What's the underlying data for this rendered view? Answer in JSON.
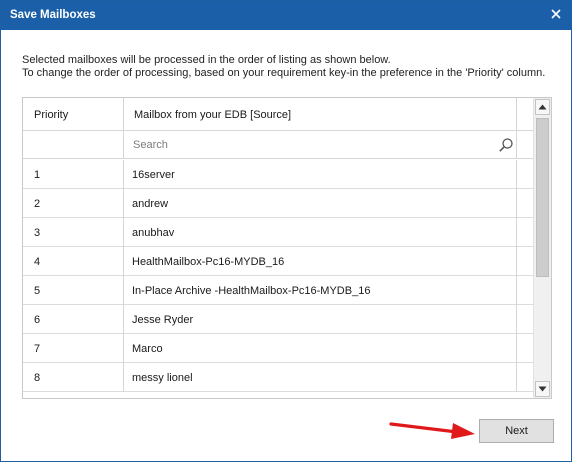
{
  "window": {
    "title": "Save Mailboxes",
    "titlebar_color": "#1b5fa9"
  },
  "description": {
    "line1": "Selected mailboxes will be processed in the order of listing as shown below.",
    "line2": "To change the order of processing, based on your requirement key-in the preference in the 'Priority' column."
  },
  "grid": {
    "columns": [
      "Priority",
      "Mailbox from your EDB [Source]"
    ],
    "search_placeholder": "Search",
    "rows": [
      {
        "priority": "1",
        "mailbox": "16server"
      },
      {
        "priority": "2",
        "mailbox": "andrew"
      },
      {
        "priority": "3",
        "mailbox": "anubhav"
      },
      {
        "priority": "4",
        "mailbox": "HealthMailbox-Pc16-MYDB_16"
      },
      {
        "priority": "5",
        "mailbox": "In-Place Archive -HealthMailbox-Pc16-MYDB_16"
      },
      {
        "priority": "6",
        "mailbox": "Jesse Ryder"
      },
      {
        "priority": "7",
        "mailbox": "Marco"
      },
      {
        "priority": "8",
        "mailbox": "messy lionel"
      }
    ]
  },
  "buttons": {
    "next": "Next"
  },
  "icons": {
    "close": "close-icon",
    "search": "search-icon",
    "scroll_up": "scroll-up-arrow-icon",
    "scroll_down": "scroll-down-arrow-icon",
    "annotation": "red-arrow-icon"
  },
  "colors": {
    "annotation_arrow": "#e0191b",
    "button_bg": "#e1e1e1"
  }
}
